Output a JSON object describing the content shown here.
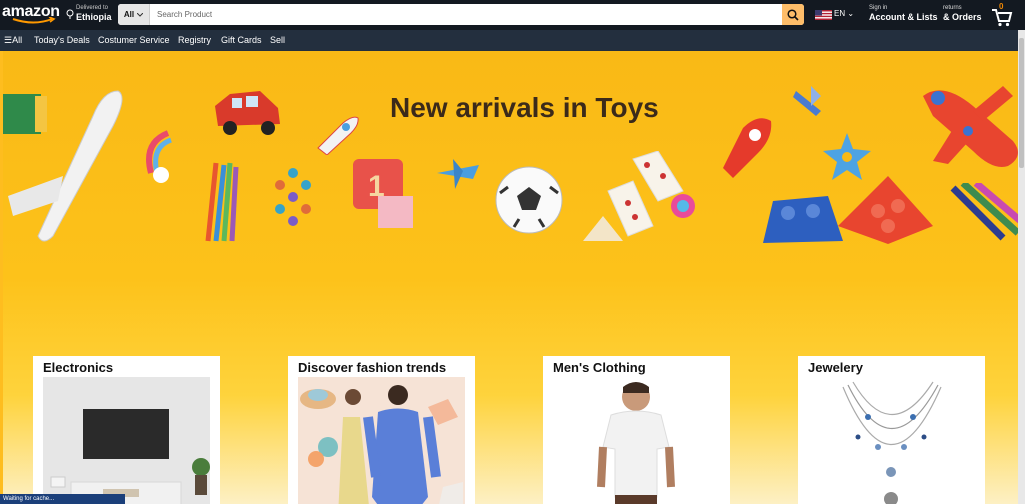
{
  "header": {
    "logo_text": "amazon",
    "deliver_line1": "Delivered to",
    "deliver_line2": "Ethiopia",
    "search_category": "All",
    "search_placeholder": "Search Product",
    "language": "EN",
    "account_line1": "Sign in",
    "account_line2": "Account & Lists",
    "returns_line1": "returns",
    "returns_line2": "& Orders",
    "cart_count": "0"
  },
  "nav": {
    "all_label": "All",
    "items": [
      "Today's Deals",
      "Costumer Service",
      "Registry",
      "Gift Cards",
      "Sell"
    ]
  },
  "hero": {
    "title": "New arrivals in Toys"
  },
  "cards": [
    {
      "title": "Electronics"
    },
    {
      "title": "Discover fashion trends"
    },
    {
      "title": "Men's Clothing"
    },
    {
      "title": "Jewelery"
    }
  ],
  "status": {
    "text": "Waiting for cache..."
  },
  "colors": {
    "header_bg": "#131921",
    "nav_bg": "#232f3e",
    "search_button": "#febd69",
    "hero_yellow": "#fdc21a",
    "cart_count": "#f08804"
  }
}
